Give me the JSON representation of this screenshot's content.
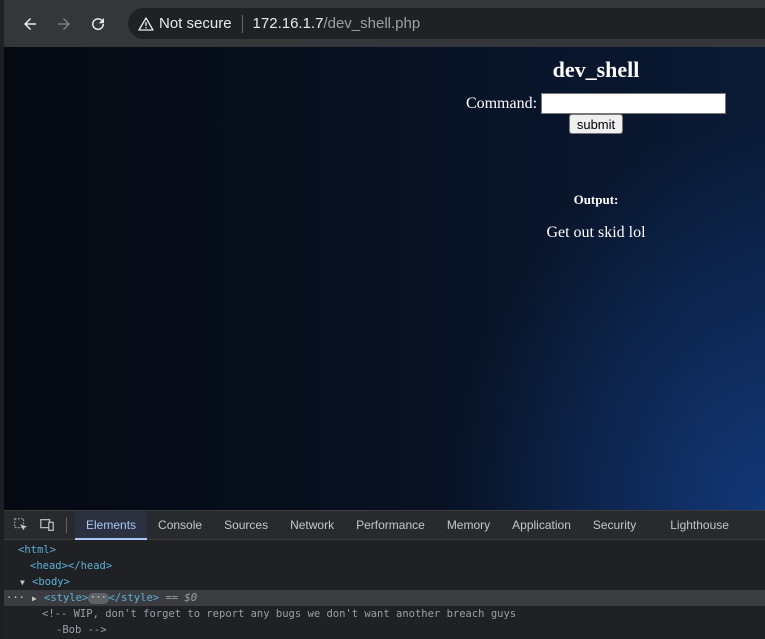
{
  "browser": {
    "security_label": "Not secure",
    "url_host": "172.16.1.7",
    "url_path": "/dev_shell.php",
    "icons": [
      "back-icon",
      "forward-icon",
      "reload-icon",
      "warning-icon"
    ]
  },
  "page": {
    "title": "dev_shell",
    "command_label": "Command:",
    "command_value": "",
    "submit_label": "submit",
    "output_label": "Output:",
    "output_text": "Get out skid lol",
    "accent_color": "#0a1a36"
  },
  "devtools": {
    "tabs": [
      "Elements",
      "Console",
      "Sources",
      "Network",
      "Performance",
      "Memory",
      "Application",
      "Security",
      "Lighthouse"
    ],
    "active_tab": "Elements",
    "dom": {
      "html_open": "<html>",
      "head": "<head></head>",
      "body_open": "<body>",
      "style_open": "<style>",
      "style_close": "</style>",
      "selected_marker": "== $0",
      "comment_line1": "<!-- WIP, don't forget to report any bugs we don't want another breach guys",
      "comment_line2": "-Bob -->"
    }
  }
}
